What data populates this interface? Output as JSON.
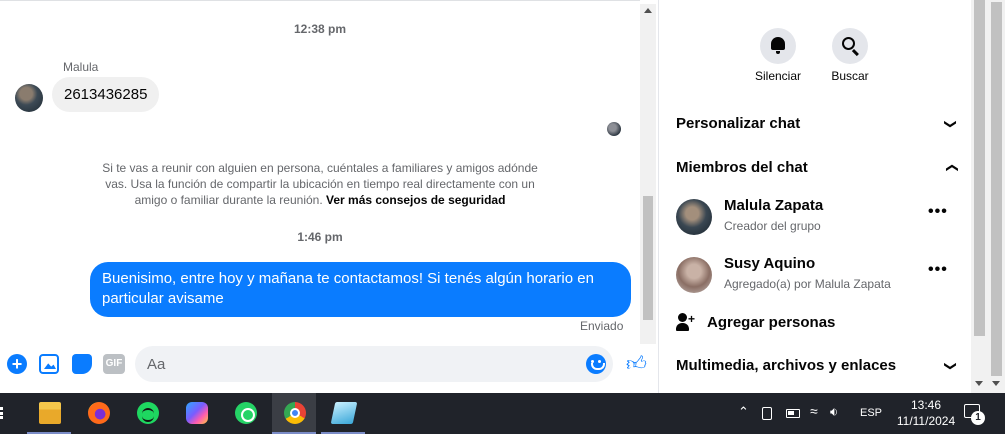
{
  "chat": {
    "timestamps": [
      "12:38 pm",
      "1:46 pm"
    ],
    "received": {
      "sender": "Malula",
      "text": "2613436285"
    },
    "safety_note": {
      "text": "Si te vas a reunir con alguien en persona, cuéntales a familiares y amigos adónde vas. Usa la función de compartir la ubicación en tiempo real directamente con un amigo o familiar durante la reunión. ",
      "link": "Ver más consejos de seguridad"
    },
    "sent": {
      "text": "Buenisimo, entre hoy y mañana te contactamos! Si tenés algún horario en particular avisame",
      "status": "Enviado"
    },
    "composer": {
      "placeholder": "Aa",
      "gif_label": "GIF",
      "accent_color": "#0a7cff"
    }
  },
  "panel": {
    "actions": [
      {
        "label": "Silenciar",
        "icon": "bell-icon"
      },
      {
        "label": "Buscar",
        "icon": "search-icon"
      }
    ],
    "sections": {
      "personalize": "Personalizar chat",
      "members": "Miembros del chat",
      "media": "Multimedia, archivos y enlaces"
    },
    "members": [
      {
        "name": "Malula Zapata",
        "subtitle": "Creador del grupo"
      },
      {
        "name": "Susy Aquino",
        "subtitle": "Agregado(a) por Malula Zapata"
      }
    ],
    "add_people": "Agregar personas",
    "more_glyph": "•••"
  },
  "taskbar": {
    "apps": [
      "file-explorer",
      "firefox",
      "spotify",
      "copilot",
      "whatsapp",
      "chrome",
      "notes"
    ],
    "active_app": "chrome",
    "tray": {
      "language": "ESP",
      "time": "13:46",
      "date": "11/11/2024",
      "notification_count": "1"
    }
  }
}
